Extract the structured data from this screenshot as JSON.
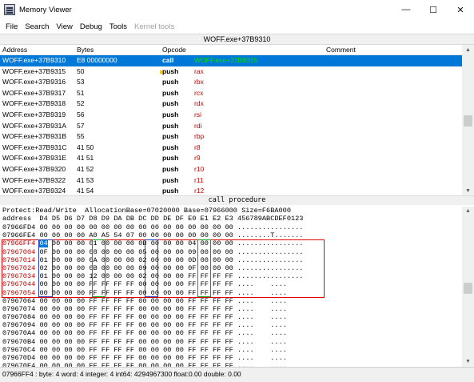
{
  "window": {
    "title": "Memory Viewer",
    "controls": [
      "—",
      "☐",
      "✕"
    ]
  },
  "menu": {
    "items": [
      {
        "label": "File"
      },
      {
        "label": "Search"
      },
      {
        "label": "View"
      },
      {
        "label": "Debug"
      },
      {
        "label": "Tools"
      },
      {
        "label": "Kernel tools"
      }
    ]
  },
  "address_bar": {
    "text": "WOFF.exe+37B9310"
  },
  "disassembler": {
    "columns": {
      "address": "Address",
      "bytes": "Bytes",
      "opcode": "Opcode",
      "comment": "Comment"
    },
    "rows": [
      {
        "address": "WOFF.exe+37B9310",
        "bytes": "E8 00000000",
        "op": "call",
        "arg": "WOFF.exe+37B9315",
        "selected": true
      },
      {
        "address": "WOFF.exe+37B9315",
        "bytes": "50",
        "op": "push",
        "arg": "rax"
      },
      {
        "address": "WOFF.exe+37B9316",
        "bytes": "53",
        "op": "push",
        "arg": "rbx"
      },
      {
        "address": "WOFF.exe+37B9317",
        "bytes": "51",
        "op": "push",
        "arg": "rcx"
      },
      {
        "address": "WOFF.exe+37B9318",
        "bytes": "52",
        "op": "push",
        "arg": "rdx"
      },
      {
        "address": "WOFF.exe+37B9319",
        "bytes": "56",
        "op": "push",
        "arg": "rsi"
      },
      {
        "address": "WOFF.exe+37B931A",
        "bytes": "57",
        "op": "push",
        "arg": "rdi"
      },
      {
        "address": "WOFF.exe+37B931B",
        "bytes": "55",
        "op": "push",
        "arg": "rbp"
      },
      {
        "address": "WOFF.exe+37B931C",
        "bytes": "41 50",
        "op": "push",
        "arg": "r8"
      },
      {
        "address": "WOFF.exe+37B931E",
        "bytes": "41 51",
        "op": "push",
        "arg": "r9"
      },
      {
        "address": "WOFF.exe+37B9320",
        "bytes": "41 52",
        "op": "push",
        "arg": "r10"
      },
      {
        "address": "WOFF.exe+37B9322",
        "bytes": "41 53",
        "op": "push",
        "arg": "r11"
      },
      {
        "address": "WOFF.exe+37B9324",
        "bytes": "41 54",
        "op": "push",
        "arg": "r12"
      }
    ],
    "status": "call procedure"
  },
  "hexview": {
    "protect_line": "Protect:Read/Write  AllocationBase=07020000 Base=07966000 Size=F6BA000",
    "header_line": "address  D4 D5 D6 D7 D8 D9 DA DB DC DD DE DF E0 E1 E2 E3 456789ABCDEF0123",
    "rows": [
      {
        "addr": "07966FD4",
        "bytes": "00 00 00 00 00 00 00 00 00 00 00 00 00 00 00 00",
        "ascii": "................"
      },
      {
        "addr": "07966FE4",
        "bytes": "00 00 00 00 A0 A5 54 07 00 00 00 00 00 00 00 00",
        "ascii": "........T......."
      },
      {
        "addr": "07966FF4",
        "bytes": "04 00 00 00 01 00 00 00 0B 00 00 00 04 00 00 00",
        "ascii": "................",
        "hl": true
      },
      {
        "addr": "07967004",
        "bytes": "0F 00 00 00 08 00 00 00 05 00 00 00 09 00 00 00",
        "ascii": "................",
        "hl": true
      },
      {
        "addr": "07967014",
        "bytes": "01 00 00 00 0A 00 00 00 02 00 00 00 0D 00 00 00",
        "ascii": "................",
        "hl": true
      },
      {
        "addr": "07967024",
        "bytes": "02 00 00 00 0B 00 00 00 09 00 00 00 0F 00 00 00",
        "ascii": "................",
        "hl": true
      },
      {
        "addr": "07967034",
        "bytes": "01 00 00 00 12 00 00 00 02 00 00 00 FF FF FF FF",
        "ascii": "................",
        "hl": true
      },
      {
        "addr": "07967044",
        "bytes": "00 00 00 00 FF FF FF FF 00 00 00 00 FF FF FF FF",
        "ascii": "....    ....    ",
        "hl": true
      },
      {
        "addr": "07967054",
        "bytes": "00 00 00 00 FF FF FF FF 00 00 00 00 FF FF FF FF",
        "ascii": "....    ....    ",
        "hl": true
      },
      {
        "addr": "07967064",
        "bytes": "00 00 00 00 FF FF FF FF 00 00 00 00 FF FF FF FF",
        "ascii": "....    ....    "
      },
      {
        "addr": "07967074",
        "bytes": "00 00 00 00 FF FF FF FF 00 00 00 00 FF FF FF FF",
        "ascii": "....    ....    "
      },
      {
        "addr": "07967084",
        "bytes": "00 00 00 00 FF FF FF FF 00 00 00 00 FF FF FF FF",
        "ascii": "....    ....    "
      },
      {
        "addr": "07967094",
        "bytes": "00 00 00 00 FF FF FF FF 00 00 00 00 FF FF FF FF",
        "ascii": "....    ....    "
      },
      {
        "addr": "079670A4",
        "bytes": "00 00 00 00 FF FF FF FF 00 00 00 00 FF FF FF FF",
        "ascii": "....    ....    "
      },
      {
        "addr": "079670B4",
        "bytes": "00 00 00 00 FF FF FF FF 00 00 00 00 FF FF FF FF",
        "ascii": "....    ....    "
      },
      {
        "addr": "079670C4",
        "bytes": "00 00 00 00 FF FF FF FF 00 00 00 00 FF FF FF FF",
        "ascii": "....    ....    "
      },
      {
        "addr": "079670D4",
        "bytes": "00 00 00 00 FF FF FF FF 00 00 00 00 FF FF FF FF",
        "ascii": "....    ....    "
      },
      {
        "addr": "079670E4",
        "bytes": "00 00 00 00 FF FF FF FF 00 00 00 00 FF FF FF FF",
        "ascii": "....    ....    "
      }
    ]
  },
  "status_bar": {
    "text": "07966FF4 : byte: 4 word: 4 integer: 4 int64: 4294967300 float:0.00 double: 0.00"
  },
  "colors": {
    "selection": "#0078d7",
    "register": "#d00000",
    "call_target": "#00e000",
    "box_red": "#e00000",
    "box_blue": "#2040c0",
    "box_green": "#10a010"
  }
}
